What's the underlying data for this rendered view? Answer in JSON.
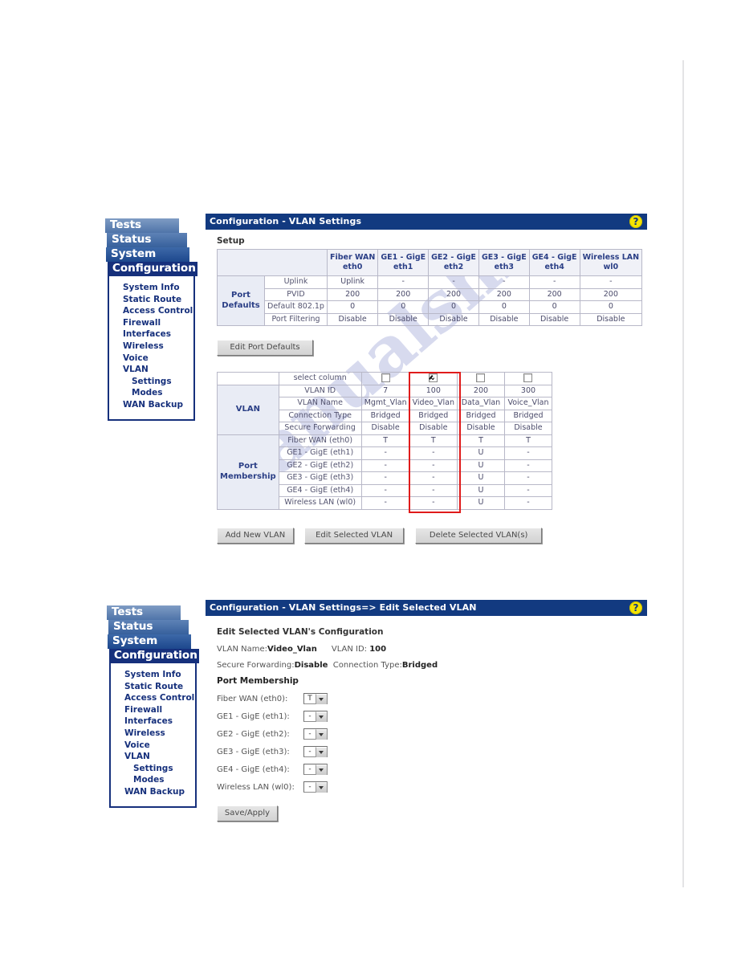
{
  "watermark": "manualshive.com",
  "sidebar": {
    "tabs": [
      "Tests",
      "Status",
      "System",
      "Configuration"
    ],
    "items": [
      {
        "label": "System Info",
        "sub": false
      },
      {
        "label": "Static Route",
        "sub": false
      },
      {
        "label": "Access Control",
        "sub": false
      },
      {
        "label": "Firewall",
        "sub": false
      },
      {
        "label": "Interfaces",
        "sub": false
      },
      {
        "label": "Wireless",
        "sub": false
      },
      {
        "label": "Voice",
        "sub": false
      },
      {
        "label": "VLAN",
        "sub": false
      },
      {
        "label": "Settings",
        "sub": true
      },
      {
        "label": "Modes",
        "sub": true
      },
      {
        "label": "WAN Backup",
        "sub": false
      }
    ]
  },
  "panel1": {
    "title": "Configuration - VLAN Settings",
    "help_icon": "?",
    "setup_label": "Setup",
    "port_defaults": {
      "row_label_line1": "Port",
      "row_label_line2": "Defaults",
      "columns": [
        {
          "name": "Fiber WAN",
          "iface": "eth0"
        },
        {
          "name": "GE1 - GigE",
          "iface": "eth1"
        },
        {
          "name": "GE2 - GigE",
          "iface": "eth2"
        },
        {
          "name": "GE3 - GigE",
          "iface": "eth3"
        },
        {
          "name": "GE4 - GigE",
          "iface": "eth4"
        },
        {
          "name": "Wireless LAN",
          "iface": "wl0"
        }
      ],
      "rows": [
        {
          "label": "Uplink",
          "values": [
            "Uplink",
            "-",
            "-",
            "-",
            "-",
            "-"
          ]
        },
        {
          "label": "PVID",
          "values": [
            "200",
            "200",
            "200",
            "200",
            "200",
            "200"
          ]
        },
        {
          "label": "Default 802.1p",
          "values": [
            "0",
            "0",
            "0",
            "0",
            "0",
            "0"
          ]
        },
        {
          "label": "Port Filtering",
          "values": [
            "Disable",
            "Disable",
            "Disable",
            "Disable",
            "Disable",
            "Disable"
          ]
        }
      ]
    },
    "edit_port_defaults_button": "Edit Port Defaults",
    "vlan_table": {
      "select_column_label": "select column",
      "vlan_group_label": "VLAN",
      "port_membership_label_line1": "Port",
      "port_membership_label_line2": "Membership",
      "checkboxes": [
        false,
        true,
        false,
        false
      ],
      "selected_index": 1,
      "vlan_rows": [
        {
          "label": "VLAN ID",
          "values": [
            "7",
            "100",
            "200",
            "300"
          ]
        },
        {
          "label": "VLAN Name",
          "values": [
            "Mgmt_Vlan",
            "Video_Vlan",
            "Data_Vlan",
            "Voice_Vlan"
          ]
        },
        {
          "label": "Connection Type",
          "values": [
            "Bridged",
            "Bridged",
            "Bridged",
            "Bridged"
          ]
        },
        {
          "label": "Secure Forwarding",
          "values": [
            "Disable",
            "Disable",
            "Disable",
            "Disable"
          ]
        }
      ],
      "membership_rows": [
        {
          "label": "Fiber WAN (eth0)",
          "values": [
            "T",
            "T",
            "T",
            "T"
          ]
        },
        {
          "label": "GE1 - GigE (eth1)",
          "values": [
            "-",
            "-",
            "U",
            "-"
          ]
        },
        {
          "label": "GE2 - GigE (eth2)",
          "values": [
            "-",
            "-",
            "U",
            "-"
          ]
        },
        {
          "label": "GE3 - GigE (eth3)",
          "values": [
            "-",
            "-",
            "U",
            "-"
          ]
        },
        {
          "label": "GE4 - GigE (eth4)",
          "values": [
            "-",
            "-",
            "U",
            "-"
          ]
        },
        {
          "label": "Wireless LAN (wl0)",
          "values": [
            "-",
            "-",
            "U",
            "-"
          ]
        }
      ]
    },
    "buttons": {
      "add": "Add New VLAN",
      "edit": "Edit Selected VLAN",
      "delete": "Delete Selected VLAN(s)"
    }
  },
  "panel2": {
    "title": "Configuration - VLAN Settings=> Edit Selected VLAN",
    "help_icon": "?",
    "heading": "Edit Selected VLAN's Configuration",
    "vlan_name_label": "VLAN Name:",
    "vlan_name_value": "Video_Vlan",
    "vlan_id_label": "VLAN ID: ",
    "vlan_id_value": "100",
    "secure_forwarding_label": "Secure Forwarding:",
    "secure_forwarding_value": "Disable",
    "connection_type_label": "Connection Type:",
    "connection_type_value": "Bridged",
    "port_membership_label": "Port Membership",
    "ports": [
      {
        "label": "Fiber WAN (eth0):",
        "value": "T"
      },
      {
        "label": "GE1 - GigE (eth1):",
        "value": "-"
      },
      {
        "label": "GE2 - GigE (eth2):",
        "value": "-"
      },
      {
        "label": "GE3 - GigE (eth3):",
        "value": "-"
      },
      {
        "label": "GE4 - GigE (eth4):",
        "value": "-"
      },
      {
        "label": "Wireless LAN (wl0):",
        "value": "-"
      }
    ],
    "save_button": "Save/Apply"
  }
}
